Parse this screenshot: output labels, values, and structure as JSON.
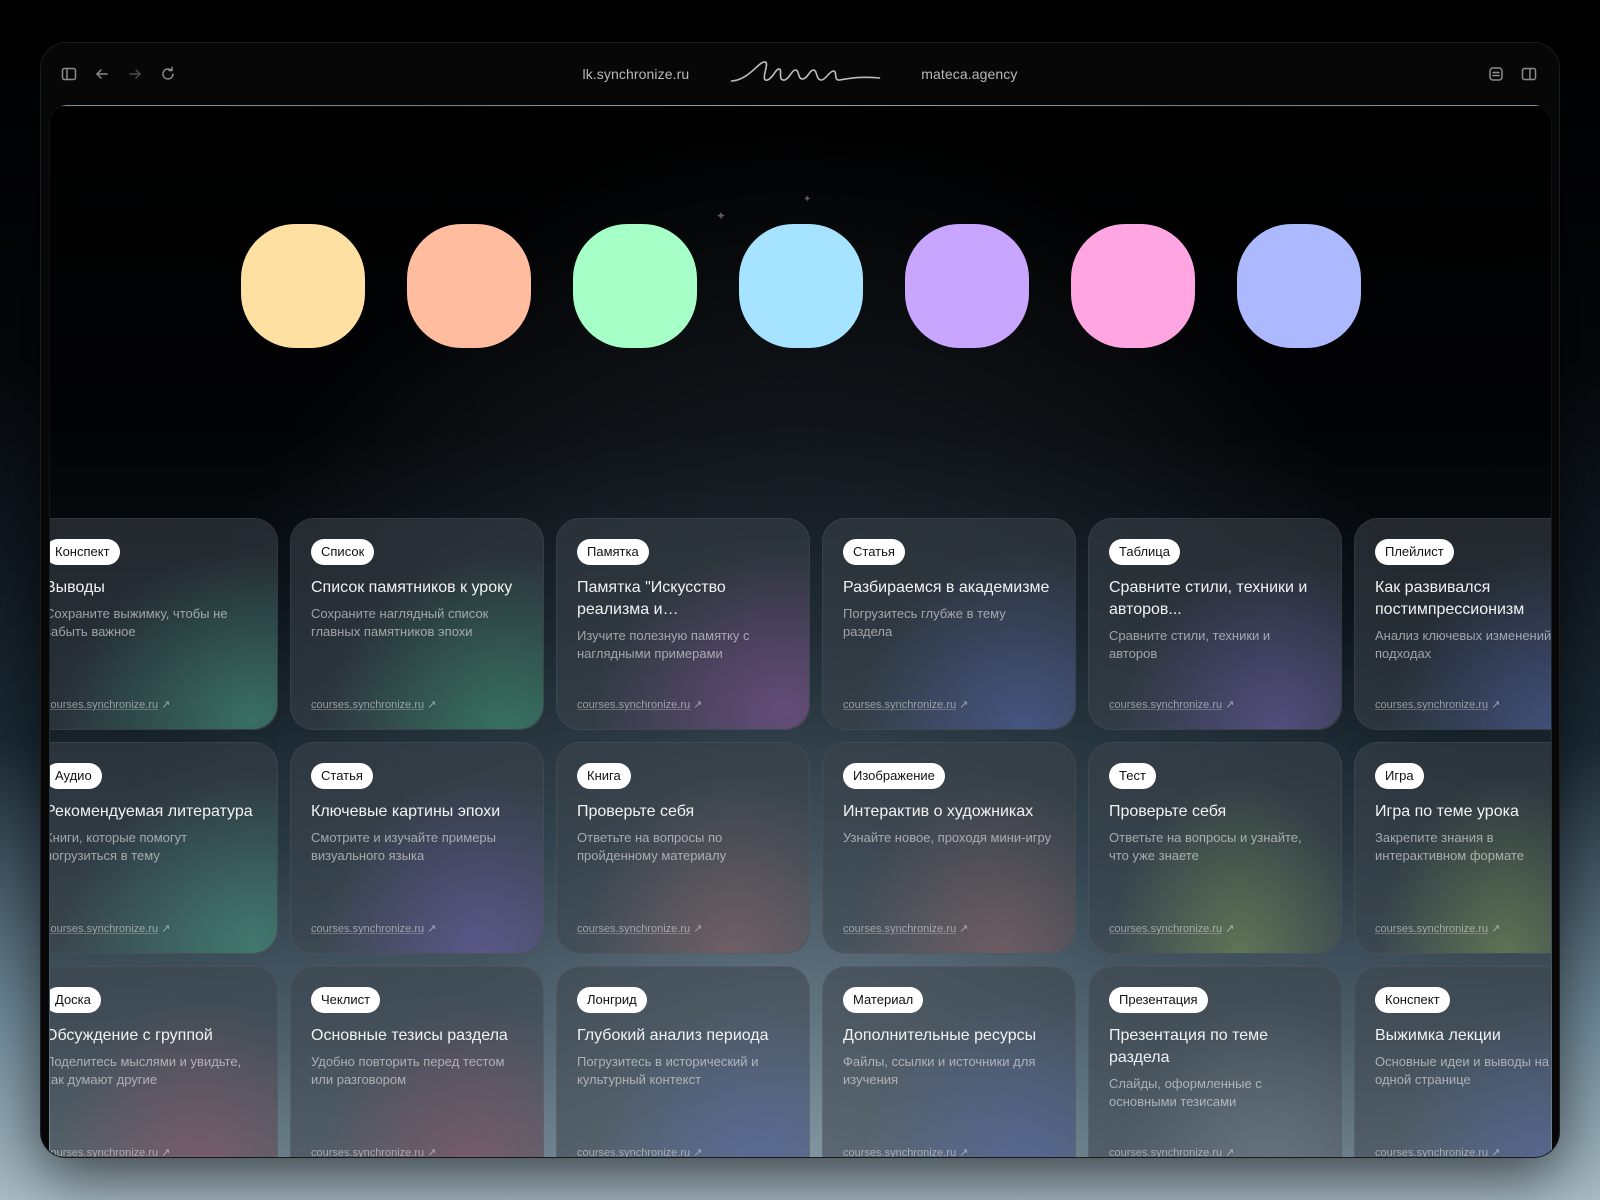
{
  "browser": {
    "left_url": "lk.synchronize.ru",
    "right_url": "mateca.agency",
    "logo_text": "мацa"
  },
  "palette": [
    "#FFE0A3",
    "#FFBC9E",
    "#A6FFC6",
    "#A6E3FF",
    "#C8A6FF",
    "#FFA6E2",
    "#ADB9FF"
  ],
  "cards": [
    {
      "badge": "Конспект",
      "title": "Выводы",
      "desc": "Сохраните выжимку, чтобы не забыть важное",
      "link": "courses.synchronize.ru",
      "glow": "teal"
    },
    {
      "badge": "Список",
      "title": "Список памятников к уроку",
      "desc": "Сохраните наглядный список главных памятников эпохи",
      "link": "courses.synchronize.ru",
      "glow": "green"
    },
    {
      "badge": "Памятка",
      "title": "Памятка \"Искусство реализма и импрессионизма\"",
      "desc": "Изучите полезную памятку с наглядными примерами",
      "link": "courses.synchronize.ru",
      "glow": "purple"
    },
    {
      "badge": "Статья",
      "title": "Разбираемся в академизме",
      "desc": "Погрузитесь глубже в тему раздела",
      "link": "courses.synchronize.ru",
      "glow": "blue"
    },
    {
      "badge": "Таблица",
      "title": "Сравните стили, техники и авторов...",
      "desc": "Сравните стили, техники и авторов",
      "link": "courses.synchronize.ru",
      "glow": "violet"
    },
    {
      "badge": "Плейлист",
      "title": "Как развивался постимпрессионизм",
      "desc": "Анализ ключевых изменений в подходах",
      "link": "courses.synchronize.ru",
      "glow": "blue"
    },
    {
      "badge": "Аудио",
      "title": "Рекомендуемая литература",
      "desc": "Книги, которые помогут погрузиться в тему",
      "link": "courses.synchronize.ru",
      "glow": "teal"
    },
    {
      "badge": "Статья",
      "title": "Ключевые картины эпохи",
      "desc": "Смотрите и изучайте примеры визуального языка",
      "link": "courses.synchronize.ru",
      "glow": "violet"
    },
    {
      "badge": "Книга",
      "title": "Проверьте себя",
      "desc": "Ответьте на вопросы по пройденному материалу",
      "link": "courses.synchronize.ru",
      "glow": "warm"
    },
    {
      "badge": "Изображение",
      "title": "Интерактив о художниках",
      "desc": "Узнайте новое, проходя мини-игру",
      "link": "courses.synchronize.ru",
      "glow": "warm"
    },
    {
      "badge": "Тест",
      "title": "Проверьте себя",
      "desc": "Ответьте на вопросы и узнайте, что уже знаете",
      "link": "courses.synchronize.ru",
      "glow": "olive"
    },
    {
      "badge": "Игра",
      "title": "Игра по теме урока",
      "desc": "Закрепите знания в интерактивном формате",
      "link": "courses.synchronize.ru",
      "glow": "olive"
    },
    {
      "badge": "Доска",
      "title": "Обсуждение с группой",
      "desc": "Поделитесь мыслями и увидьте, как думают другие",
      "link": "courses.synchronize.ru",
      "glow": "rose"
    },
    {
      "badge": "Чеклист",
      "title": "Основные тезисы раздела",
      "desc": "Удобно повторить перед тестом или разговором",
      "link": "courses.synchronize.ru",
      "glow": "rose"
    },
    {
      "badge": "Лонгрид",
      "title": "Глубокий анализ периода",
      "desc": "Погрузитесь в исторический и культурный контекст",
      "link": "courses.synchronize.ru",
      "glow": "blue"
    },
    {
      "badge": "Материал",
      "title": "Дополнительные ресурсы",
      "desc": "Файлы, ссылки и источники для изучения",
      "link": "courses.synchronize.ru",
      "glow": "blue"
    },
    {
      "badge": "Презентация",
      "title": "Презентация по теме раздела",
      "desc": "Слайды, оформленные с основными тезисами",
      "link": "courses.synchronize.ru",
      "glow": "gray"
    },
    {
      "badge": "Конспект",
      "title": "Выжимка лекции",
      "desc": "Основные идеи и выводы на одной странице",
      "link": "courses.synchronize.ru",
      "glow": "blue"
    }
  ]
}
